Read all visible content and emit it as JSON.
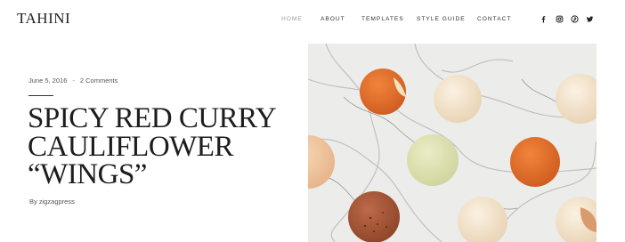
{
  "header": {
    "logo": "TAHINI",
    "nav": [
      {
        "label": "HOME",
        "active": true
      },
      {
        "label": "ABOUT",
        "active": false
      },
      {
        "label": "TEMPLATES",
        "active": false
      },
      {
        "label": "STYLE GUIDE",
        "active": false
      },
      {
        "label": "CONTACT",
        "active": false
      }
    ],
    "social": [
      "facebook-icon",
      "instagram-icon",
      "pinterest-icon",
      "twitter-icon"
    ]
  },
  "post": {
    "date": "June 5, 2016",
    "separator": "-",
    "comments": "2 Comments",
    "title_lines": [
      "SPICY RED CURRY",
      "CAULIFLOWER",
      "“WINGS”"
    ],
    "byline": "By zigzagpress"
  },
  "image": {
    "subject": "macarons on marble",
    "colors": {
      "marble": "#ededed",
      "orange": "#e06d2a",
      "cream": "#f3e3cb",
      "peach": "#f2c9a0",
      "pistachio": "#dfe3b4",
      "chocolate": "#a9593a"
    }
  }
}
